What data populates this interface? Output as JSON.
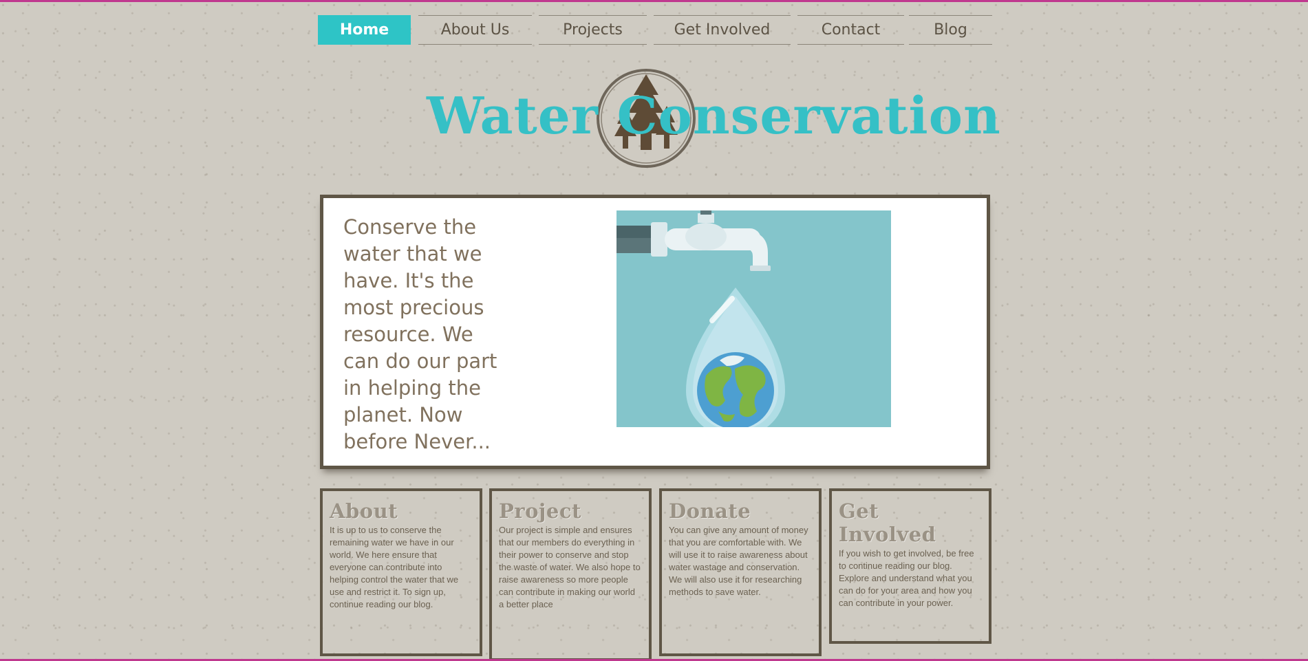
{
  "nav": {
    "items": [
      {
        "label": "Home",
        "active": true
      },
      {
        "label": "About Us",
        "active": false
      },
      {
        "label": "Projects",
        "active": false
      },
      {
        "label": "Get Involved",
        "active": false
      },
      {
        "label": "Contact",
        "active": false
      },
      {
        "label": "Blog",
        "active": false
      }
    ]
  },
  "logo": {
    "title": "Water Conservation",
    "icon": "pine-trees-circle-icon"
  },
  "hero": {
    "text": "Conserve the water that we have. It's the most precious resource. We can do our part in helping the planet. Now before Never...",
    "image_icon": "faucet-earth-drop-illustration"
  },
  "cards": [
    {
      "title": "About",
      "body": "It is up to us to conserve the remaining water we have in our world. We here ensure that everyone can contribute into helping control the water that we use and restrict it. To sign up, continue reading our blog."
    },
    {
      "title": "Project",
      "body": "Our project is simple and ensures that our members do everything in their power to conserve and stop the waste of water. We also hope to raise awareness so more people can contribute in making our world a better place"
    },
    {
      "title": "Donate",
      "body": "You can give any amount of money that you are comfortable with. We will use it to raise awareness about water wastage and conservation. We will also use it for researching methods to save water."
    },
    {
      "title": "Get Involved",
      "body": "If you wish to get involved, be free to continue reading our blog. Explore and understand what you can do for your area and how you can contribute in your power."
    }
  ],
  "colors": {
    "accent": "#2ec4c6",
    "border": "#5f5646",
    "text": "#80715d",
    "background": "#cfcbc2"
  }
}
